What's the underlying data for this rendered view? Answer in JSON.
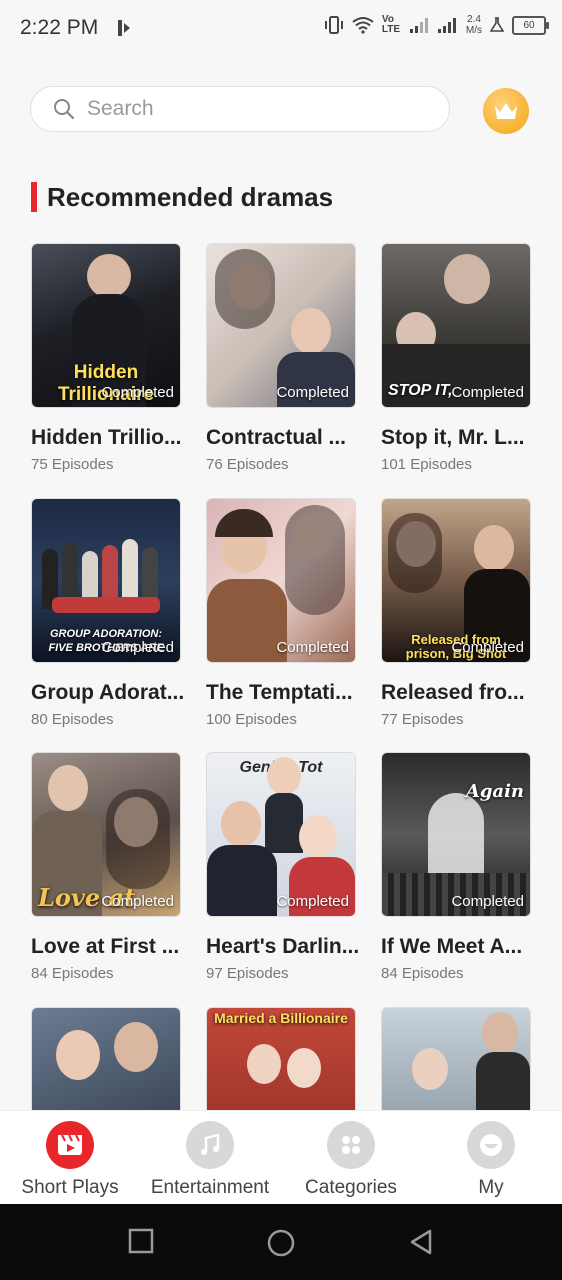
{
  "status": {
    "time": "2:22 PM",
    "network": "Vo LTE",
    "speed_top": "2.4",
    "speed_bottom": "M/s",
    "battery": "60"
  },
  "search": {
    "placeholder": "Search"
  },
  "section": {
    "title": "Recommended dramas"
  },
  "dramas": [
    {
      "title": "Hidden Trillio...",
      "episodes": "75 Episodes",
      "status": "Completed",
      "poster_text": "Hidden Trillionaire"
    },
    {
      "title": "Contractual ...",
      "episodes": "76 Episodes",
      "status": "Completed",
      "poster_text": ""
    },
    {
      "title": "Stop it, Mr. L...",
      "episodes": "101 Episodes",
      "status": "Completed",
      "poster_text": "STOP IT,"
    },
    {
      "title": "Group Adorat...",
      "episodes": "80 Episodes",
      "status": "Completed",
      "poster_text": "GROUP ADORATION: FIVE BROTHERS ARE"
    },
    {
      "title": "The Temptati...",
      "episodes": "100 Episodes",
      "status": "Completed",
      "poster_text": ""
    },
    {
      "title": "Released fro...",
      "episodes": "77 Episodes",
      "status": "Completed",
      "poster_text": "Released from prison, Big Shot"
    },
    {
      "title": "Love at First ...",
      "episodes": "84 Episodes",
      "status": "Completed",
      "poster_text": "Love at"
    },
    {
      "title": "Heart's Darlin...",
      "episodes": "97 Episodes",
      "status": "Completed",
      "poster_text": "Genius Tot"
    },
    {
      "title": "If We Meet A...",
      "episodes": "84 Episodes",
      "status": "Completed",
      "poster_text": "Again"
    },
    {
      "title": "",
      "episodes": "",
      "status": "",
      "poster_text": ""
    },
    {
      "title": "",
      "episodes": "",
      "status": "",
      "poster_text": "Married a Billionaire"
    },
    {
      "title": "",
      "episodes": "",
      "status": "",
      "poster_text": ""
    }
  ],
  "nav": [
    {
      "label": "Short Plays",
      "icon": "film-icon",
      "color": "#e8262c"
    },
    {
      "label": "Entertainment",
      "icon": "music-note-icon",
      "color": "#d8d8d8"
    },
    {
      "label": "Categories",
      "icon": "grid-icon",
      "color": "#d8d8d8"
    },
    {
      "label": "My",
      "icon": "profile-icon",
      "color": "#d8d8d8"
    }
  ]
}
